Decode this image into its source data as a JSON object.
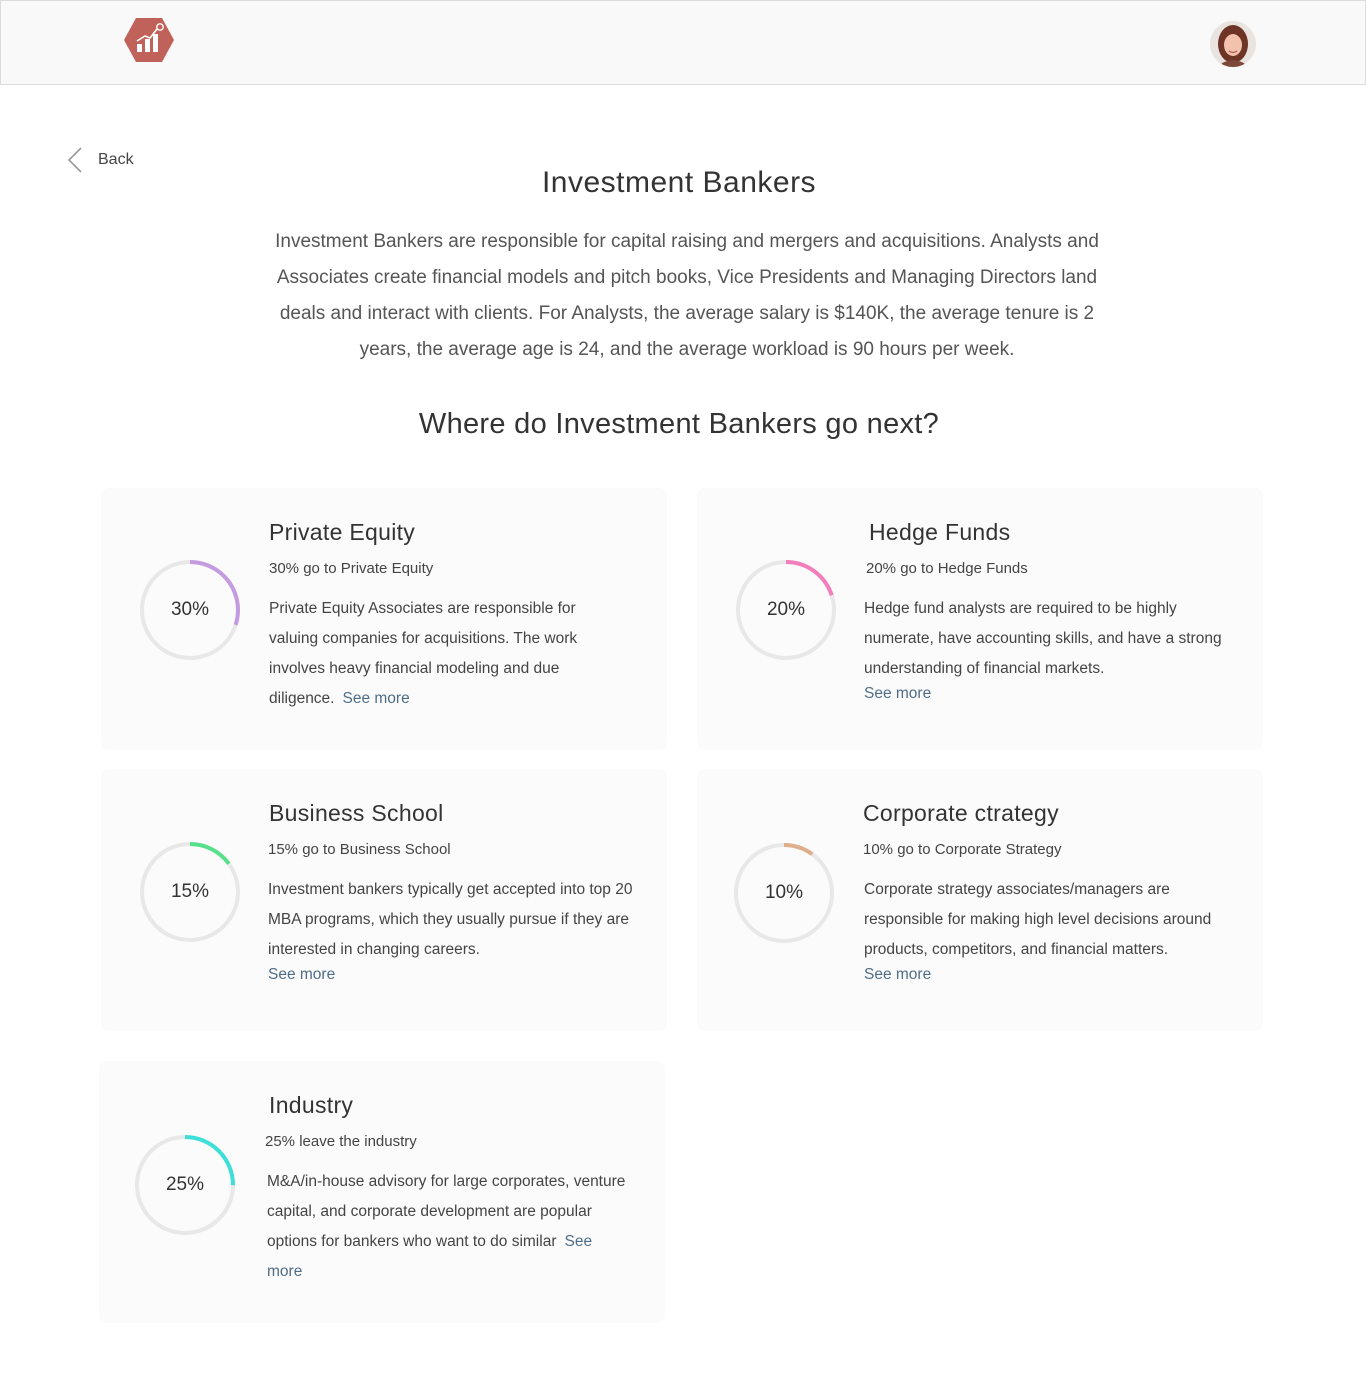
{
  "colors": {
    "logo": "#c0625a",
    "ring_track": "#e8e8e8",
    "link": "#4f6d88"
  },
  "header": {
    "logo_icon": "bar-chart-hexagon-icon",
    "avatar_icon": "user-avatar"
  },
  "back": {
    "icon": "chevron-left-icon",
    "label": "Back"
  },
  "page": {
    "title": "Investment Bankers",
    "intro": "Investment Bankers are responsible for capital raising and mergers and acquisitions. Analysts and Associates create financial models and pitch books, Vice Presidents and Managing Directors land deals and interact with clients. For Analysts, the average salary is $140K, the average tenure is 2 years, the average age is 24, and the average workload is 90 hours per week.",
    "section_title": "Where do Investment Bankers go next?"
  },
  "cards": [
    {
      "title": "Private Equity",
      "subtitle": "30% go to Private Equity",
      "percent": 30,
      "percent_label": "30%",
      "color": "#c49be0",
      "description": "Private Equity Associates are responsible for valuing companies for acquisitions. The work involves heavy financial modeling and due diligence.",
      "see_more": "See more"
    },
    {
      "title": "Hedge Funds",
      "subtitle": "20% go to Hedge Funds",
      "percent": 20,
      "percent_label": "20%",
      "color": "#f27fbb",
      "description": "Hedge fund analysts are required to be highly numerate, have accounting skills, and have a strong understanding of financial markets.",
      "see_more": "See more"
    },
    {
      "title": "Business School",
      "subtitle": "15% go to Business School",
      "percent": 15,
      "percent_label": "15%",
      "color": "#56e08c",
      "description": "Investment bankers typically get accepted into top 20 MBA programs, which they usually pursue if they are interested in changing careers.",
      "see_more": "See more"
    },
    {
      "title": "Corporate ctrategy",
      "subtitle": "10% go to Corporate Strategy",
      "percent": 10,
      "percent_label": "10%",
      "color": "#dfae8a",
      "description": "Corporate strategy associates/managers are responsible for making high level decisions around products, competitors, and financial matters.",
      "see_more": "See more"
    },
    {
      "title": "Industry",
      "subtitle": "25% leave the industry",
      "percent": 25,
      "percent_label": "25%",
      "color": "#3fdfd9",
      "description": "M&A/in-house advisory for large corporates, venture capital, and corporate development are popular options for bankers who want to do similar",
      "see_more": "See more"
    }
  ]
}
